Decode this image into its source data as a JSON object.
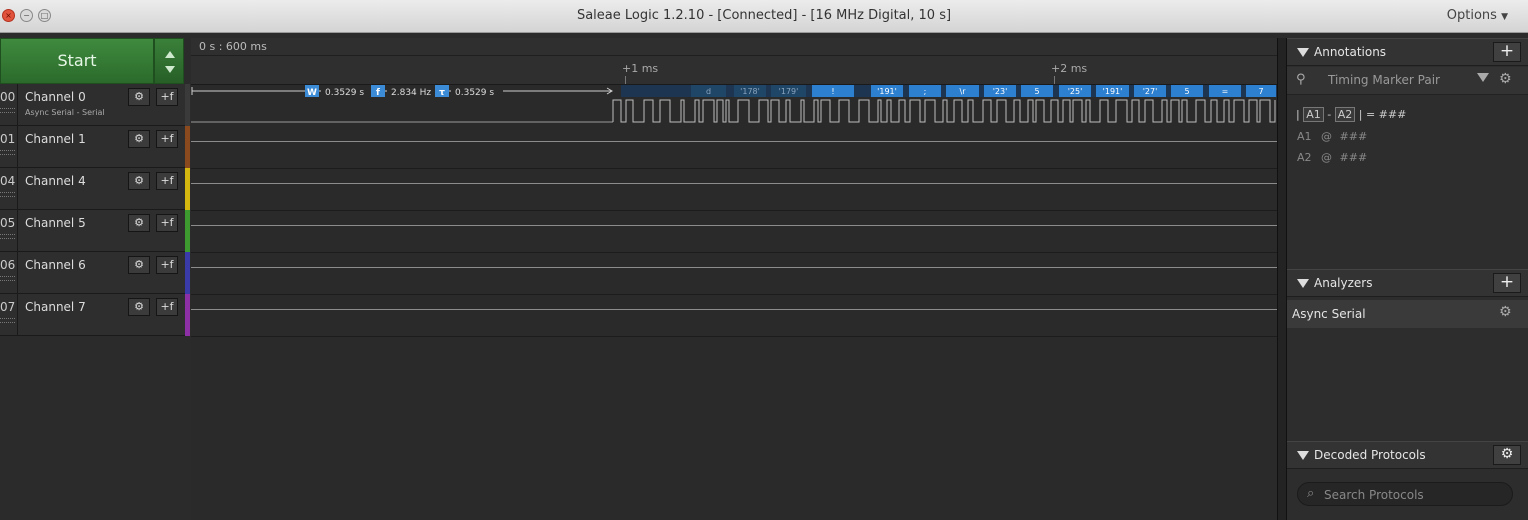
{
  "window": {
    "title": "Saleae Logic 1.2.10 - [Connected] - [16 MHz Digital, 10 s]",
    "options_label": "Options",
    "close_glyph": "×",
    "minimize_glyph": "−",
    "maximize_glyph": "□"
  },
  "start_button": {
    "label": "Start"
  },
  "channels": [
    {
      "num": "00",
      "name": "Channel 0",
      "sub": "Async Serial - Serial",
      "color": ""
    },
    {
      "num": "01",
      "name": "Channel 1",
      "color": "#8b4a1d"
    },
    {
      "num": "04",
      "name": "Channel 4",
      "color": "#d4b70f"
    },
    {
      "num": "05",
      "name": "Channel 5",
      "color": "#3c9a2e"
    },
    {
      "num": "06",
      "name": "Channel 6",
      "color": "#3a3aa8"
    },
    {
      "num": "07",
      "name": "Channel 7",
      "color": "#8d2fa5"
    }
  ],
  "channel_buttons": {
    "settings_glyph": "⚙",
    "trigger_glyph": "+f"
  },
  "timeline": {
    "origin": "0 s : 600 ms",
    "ticks": [
      "+1 ms",
      "+2 ms"
    ]
  },
  "measurement": {
    "width_tag": "W",
    "width_value": "0.3529 s",
    "freq_tag": "f",
    "freq_value": "2.834 Hz",
    "period_tag": "τ",
    "period_value": "0.3529 s"
  },
  "decoded_bytes": [
    "d",
    "'178'",
    "'179'",
    "!",
    "'191'",
    ";",
    "\\r",
    "'23'",
    "5",
    "'25'",
    "'191'",
    "'27'",
    "5",
    "=",
    "7"
  ],
  "annotations": {
    "title": "Annotations",
    "add_glyph": "+",
    "marker_pair_label": "Timing Marker Pair",
    "marker_icon_glyph": "⚲",
    "formula_bar": "|",
    "a1": "A1",
    "minus": "-",
    "a2": "A2",
    "formula_tail": "| = ###",
    "a1_label": "A1",
    "a1_at": "@",
    "a1_value": "###",
    "a2_label": "A2",
    "a2_at": "@",
    "a2_value": "###"
  },
  "analyzers": {
    "title": "Analyzers",
    "add_glyph": "+",
    "items": [
      "Async Serial"
    ]
  },
  "decoded_protocols": {
    "title": "Decoded Protocols",
    "settings_glyph": "⚙",
    "search_placeholder": "Search Protocols",
    "search_icon_glyph": "⌕"
  },
  "colors": {
    "start_green": "#2f7a2f",
    "byte_blue": "#2d7fcf"
  }
}
